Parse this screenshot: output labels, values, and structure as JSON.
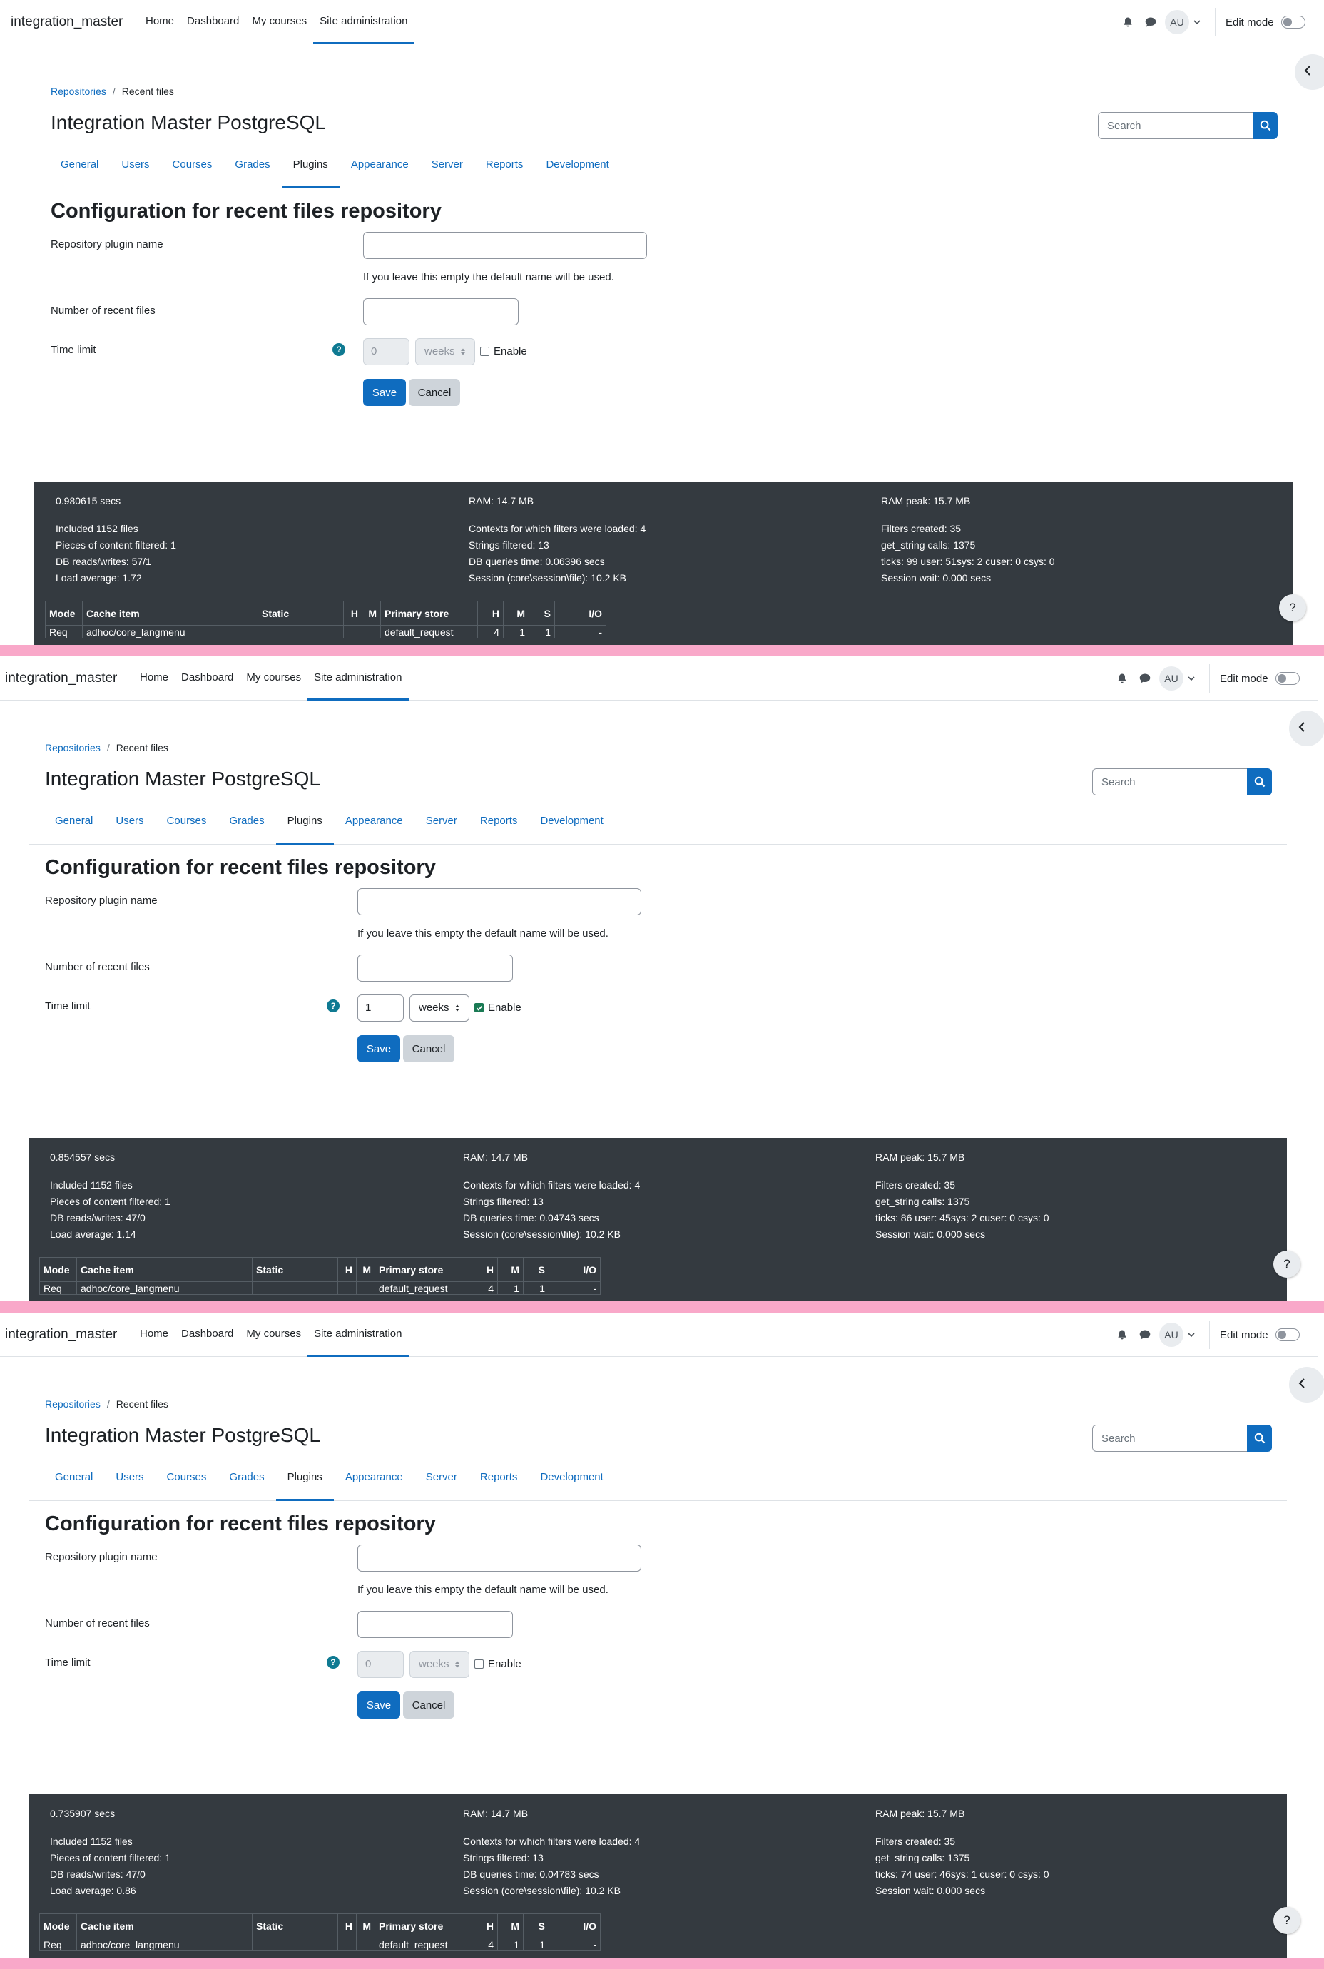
{
  "site": {
    "brand": "integration_master",
    "nav": [
      "Home",
      "Dashboard",
      "My courses",
      "Site administration"
    ],
    "active_nav": "Site administration",
    "avatar_initials": "AU",
    "edit_mode_label": "Edit mode"
  },
  "page": {
    "breadcrumb": [
      "Repositories",
      "Recent files"
    ],
    "title": "Integration Master PostgreSQL",
    "search_placeholder": "Search",
    "tabs": [
      "General",
      "Users",
      "Courses",
      "Grades",
      "Plugins",
      "Appearance",
      "Server",
      "Reports",
      "Development"
    ],
    "active_tab": "Plugins"
  },
  "form": {
    "heading": "Configuration for recent files repository",
    "plugin_name_label": "Repository plugin name",
    "plugin_name_hint": "If you leave this empty the default name will be used.",
    "recent_files_label": "Number of recent files",
    "time_limit_label": "Time limit",
    "help_glyph": "?",
    "enable_label": "Enable",
    "save_label": "Save",
    "cancel_label": "Cancel"
  },
  "perf_table": {
    "headers": [
      "Mode",
      "Cache item",
      "Static",
      "H",
      "M",
      "Primary store",
      "H",
      "M",
      "S",
      "I/O"
    ],
    "row": [
      "Req",
      "adhoc/core_langmenu",
      "",
      "",
      "",
      "default_request",
      "4",
      "1",
      "1",
      "-"
    ]
  },
  "help_button_glyph": "?",
  "snapshots": [
    {
      "time_limit": {
        "value": "0",
        "unit": "weeks",
        "enabled": false
      },
      "perf": {
        "time": "0.980615 secs",
        "ram": "RAM: 14.7 MB",
        "ram_peak": "RAM peak: 15.7 MB",
        "col1": [
          "Included 1152 files",
          "Pieces of content filtered: 1",
          "DB reads/writes: 57/1",
          "Load average: 1.72"
        ],
        "col2": [
          "Contexts for which filters were loaded: 4",
          "Strings filtered: 13",
          "DB queries time: 0.06396 secs",
          "Session (core\\session\\file): 10.2 KB"
        ],
        "col3": [
          "Filters created: 35",
          "get_string calls: 1375",
          "ticks: 99 user: 51sys: 2 cuser: 0 csys: 0",
          "Session wait: 0.000 secs"
        ]
      }
    },
    {
      "time_limit": {
        "value": "1",
        "unit": "weeks",
        "enabled": true
      },
      "perf": {
        "time": "0.854557 secs",
        "ram": "RAM: 14.7 MB",
        "ram_peak": "RAM peak: 15.7 MB",
        "col1": [
          "Included 1152 files",
          "Pieces of content filtered: 1",
          "DB reads/writes: 47/0",
          "Load average: 1.14"
        ],
        "col2": [
          "Contexts for which filters were loaded: 4",
          "Strings filtered: 13",
          "DB queries time: 0.04743 secs",
          "Session (core\\session\\file): 10.2 KB"
        ],
        "col3": [
          "Filters created: 35",
          "get_string calls: 1375",
          "ticks: 86 user: 45sys: 2 cuser: 0 csys: 0",
          "Session wait: 0.000 secs"
        ]
      }
    },
    {
      "time_limit": {
        "value": "0",
        "unit": "weeks",
        "enabled": false
      },
      "perf": {
        "time": "0.735907 secs",
        "ram": "RAM: 14.7 MB",
        "ram_peak": "RAM peak: 15.7 MB",
        "col1": [
          "Included 1152 files",
          "Pieces of content filtered: 1",
          "DB reads/writes: 47/0",
          "Load average: 0.86"
        ],
        "col2": [
          "Contexts for which filters were loaded: 4",
          "Strings filtered: 13",
          "DB queries time: 0.04783 secs",
          "Session (core\\session\\file): 10.2 KB"
        ],
        "col3": [
          "Filters created: 35",
          "get_string calls: 1375",
          "ticks: 74 user: 46sys: 1 cuser: 0 csys: 0",
          "Session wait: 0.000 secs"
        ]
      }
    }
  ],
  "colors": {
    "primary": "#0f6cbf",
    "footer_bg": "#343a40",
    "frame_separator": "#f9a8c9"
  }
}
